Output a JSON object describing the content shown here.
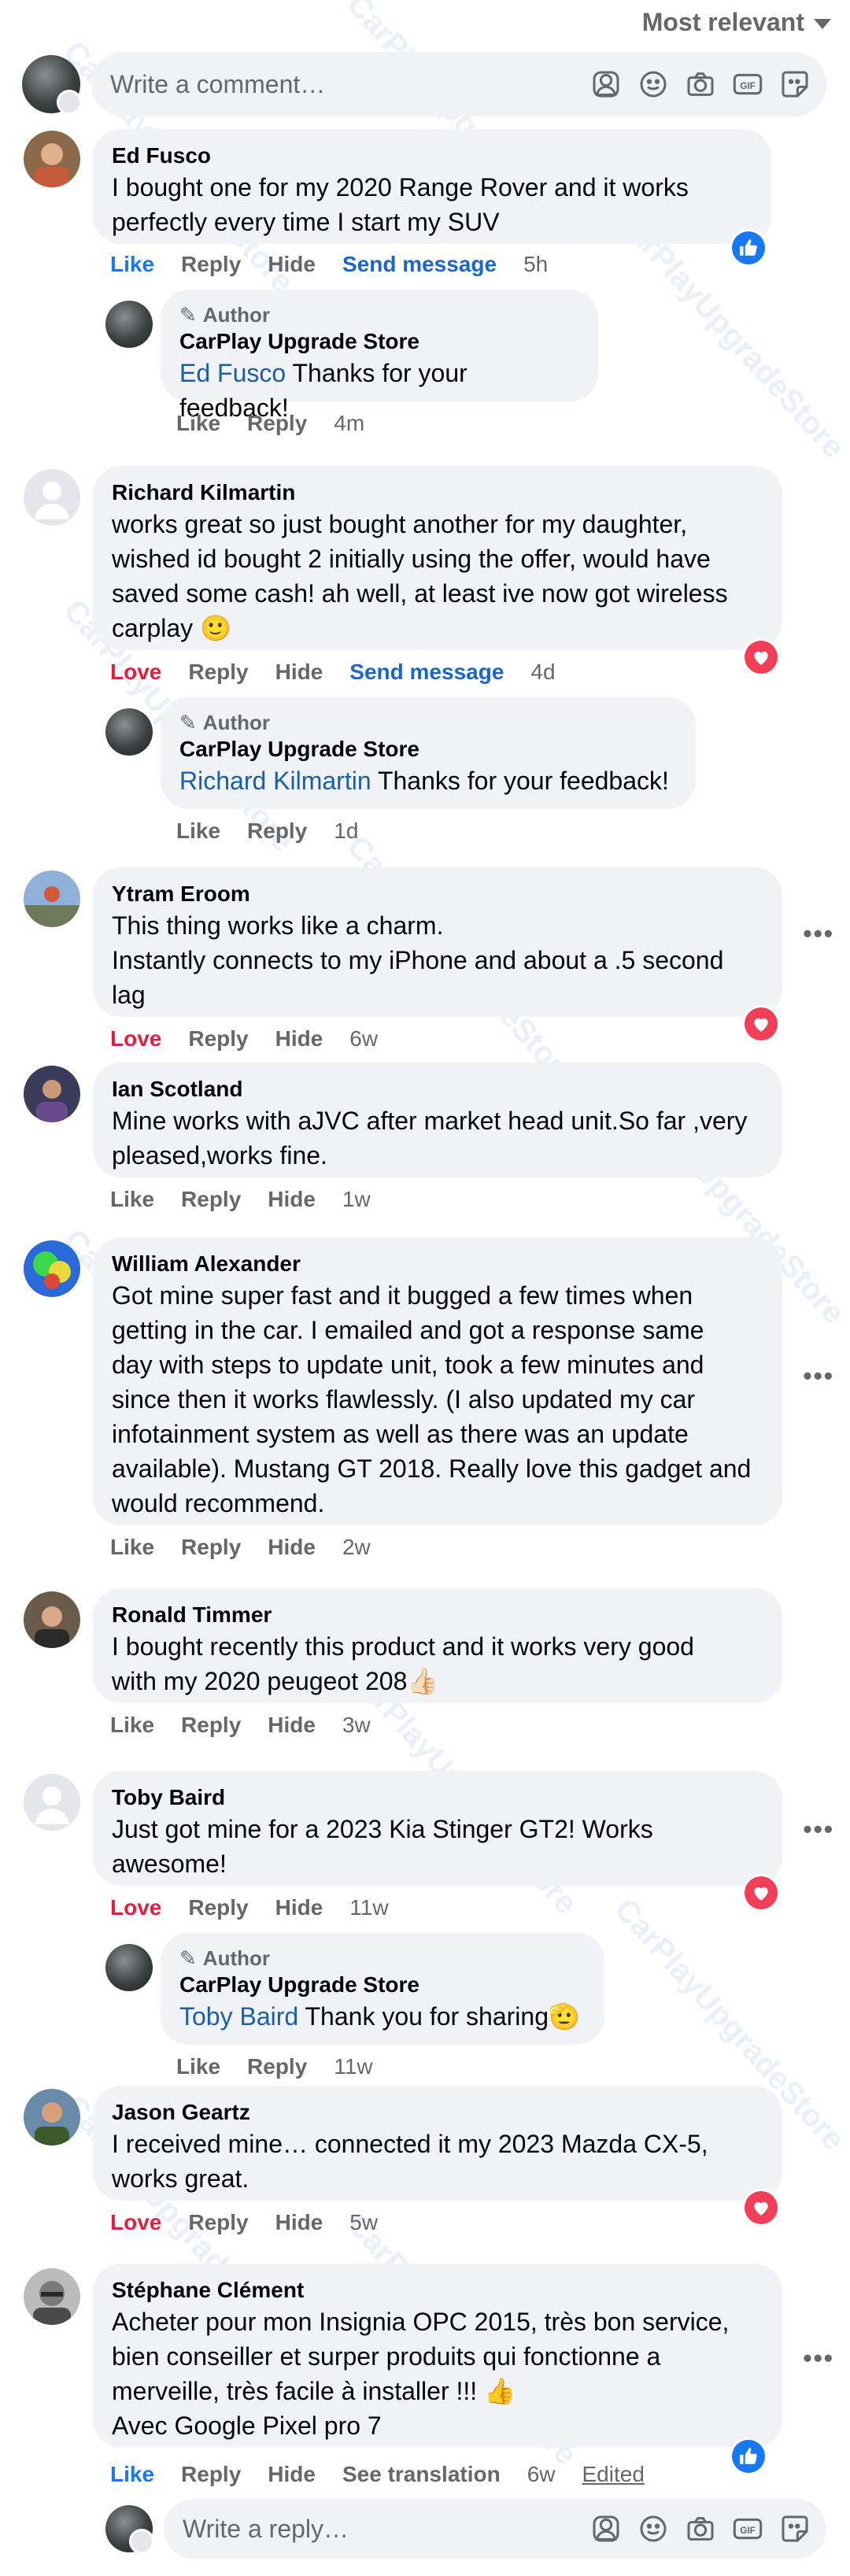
{
  "sort_label": "Most relevant",
  "composer": {
    "placeholder": "Write a comment…"
  },
  "reply_composer": {
    "placeholder": "Write a reply…"
  },
  "watermark_text": "CarPlayUpgradeStore",
  "labels": {
    "like": "Like",
    "love": "Love",
    "reply": "Reply",
    "hide": "Hide",
    "send_message": "Send message",
    "see_translation": "See translation",
    "edited": "Edited",
    "author_tag": "Author"
  },
  "comments": [
    {
      "name": "Ed Fusco",
      "lines": [
        "I bought one for my 2020 Range Rover and it works",
        "perfectly every time I start my SUV"
      ],
      "reaction": "Like",
      "time": "5h",
      "badge": "like"
    },
    {
      "name": "Richard Kilmartin",
      "lines": [
        "works great so just bought another for my daughter,",
        "wished id bought 2 initially using the offer, would have",
        "saved some cash! ah well, at least ive now got wireless",
        "carplay 🙂"
      ],
      "reaction": "Love",
      "time": "4d",
      "badge": "love"
    },
    {
      "name": "Ytram Eroom",
      "lines": [
        "This thing works like a charm.",
        "Instantly connects to my iPhone and about a .5 second",
        "lag"
      ],
      "reaction": "Love",
      "time": "6w",
      "badge": "love"
    },
    {
      "name": "Ian Scotland",
      "lines": [
        "Mine works with aJVC after market head unit.So far ,very",
        "pleased,works fine."
      ],
      "reaction": "Like",
      "time": "1w"
    },
    {
      "name": "William Alexander",
      "lines": [
        "Got mine super fast and it bugged a few times when",
        "getting in the car. I emailed and got a response same",
        "day with steps to update unit, took a few minutes and",
        "since then it works flawlessly. (I also updated my car",
        "infotainment system as well as there was an update",
        "available). Mustang GT 2018. Really love this gadget and",
        "would recommend."
      ],
      "reaction": "Like",
      "time": "2w"
    },
    {
      "name": "Ronald Timmer",
      "lines": [
        "I bought recently this product and it works very good",
        "with my 2020 peugeot 208👍🏻"
      ],
      "reaction": "Like",
      "time": "3w"
    },
    {
      "name": "Toby Baird",
      "lines": [
        "Just got mine for a 2023 Kia Stinger GT2! Works",
        "awesome!"
      ],
      "reaction": "Love",
      "time": "11w",
      "badge": "love"
    },
    {
      "name": "Jason Geartz",
      "lines": [
        "I received mine… connected it my 2023 Mazda CX-5,",
        "works great."
      ],
      "reaction": "Love",
      "time": "5w",
      "badge": "love"
    },
    {
      "name": "Stéphane Clément",
      "lines": [
        "Acheter pour mon Insignia OPC 2015, très bon service,",
        "bien conseiller et surper produits qui fonctionne a",
        "merveille, très facile à installer !!! 👍",
        "Avec Google Pixel pro 7"
      ],
      "reaction": "Like",
      "time": "6w",
      "badge": "like"
    }
  ],
  "replies": [
    {
      "store": "CarPlay Upgrade Store",
      "mention": "Ed Fusco",
      "message": "Thanks for your feedback!",
      "time": "4m"
    },
    {
      "store": "CarPlay Upgrade Store",
      "mention": "Richard Kilmartin",
      "message": "Thanks for your feedback!",
      "time": "1d"
    },
    {
      "store": "CarPlay Upgrade Store",
      "mention": "Toby Baird",
      "message": "Thank you for sharing🫡",
      "time": "11w"
    }
  ],
  "colors": {
    "bubble": "#f0f2f5",
    "muted": "#65676b",
    "like_blue": "#1877f2",
    "love_red": "#e41e3f",
    "mention": "#1b5ea8"
  }
}
